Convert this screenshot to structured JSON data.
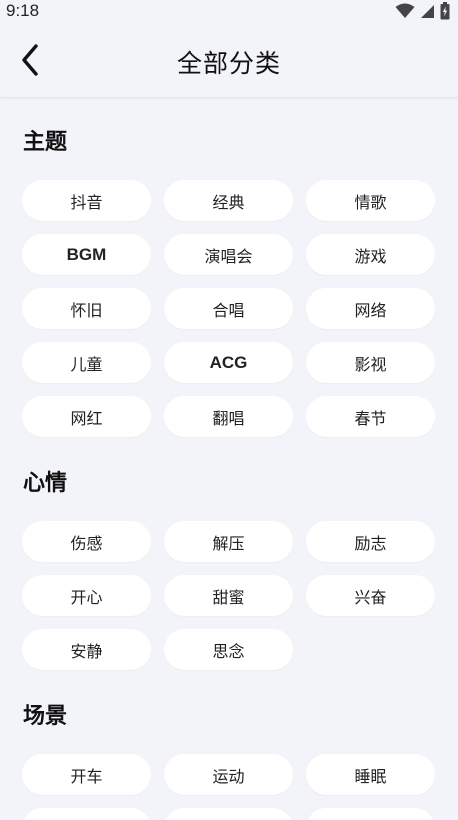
{
  "status": {
    "time": "9:18"
  },
  "header": {
    "title": "全部分类"
  },
  "sections": [
    {
      "title": "主题",
      "tags": [
        "抖音",
        "经典",
        "情歌",
        "BGM",
        "演唱会",
        "游戏",
        "怀旧",
        "合唱",
        "网络",
        "儿童",
        "ACG",
        "影视",
        "网红",
        "翻唱",
        "春节"
      ]
    },
    {
      "title": "心情",
      "tags": [
        "伤感",
        "解压",
        "励志",
        "开心",
        "甜蜜",
        "兴奋",
        "安静",
        "思念"
      ]
    },
    {
      "title": "场景",
      "tags": [
        "开车",
        "运动",
        "睡眠"
      ]
    }
  ]
}
